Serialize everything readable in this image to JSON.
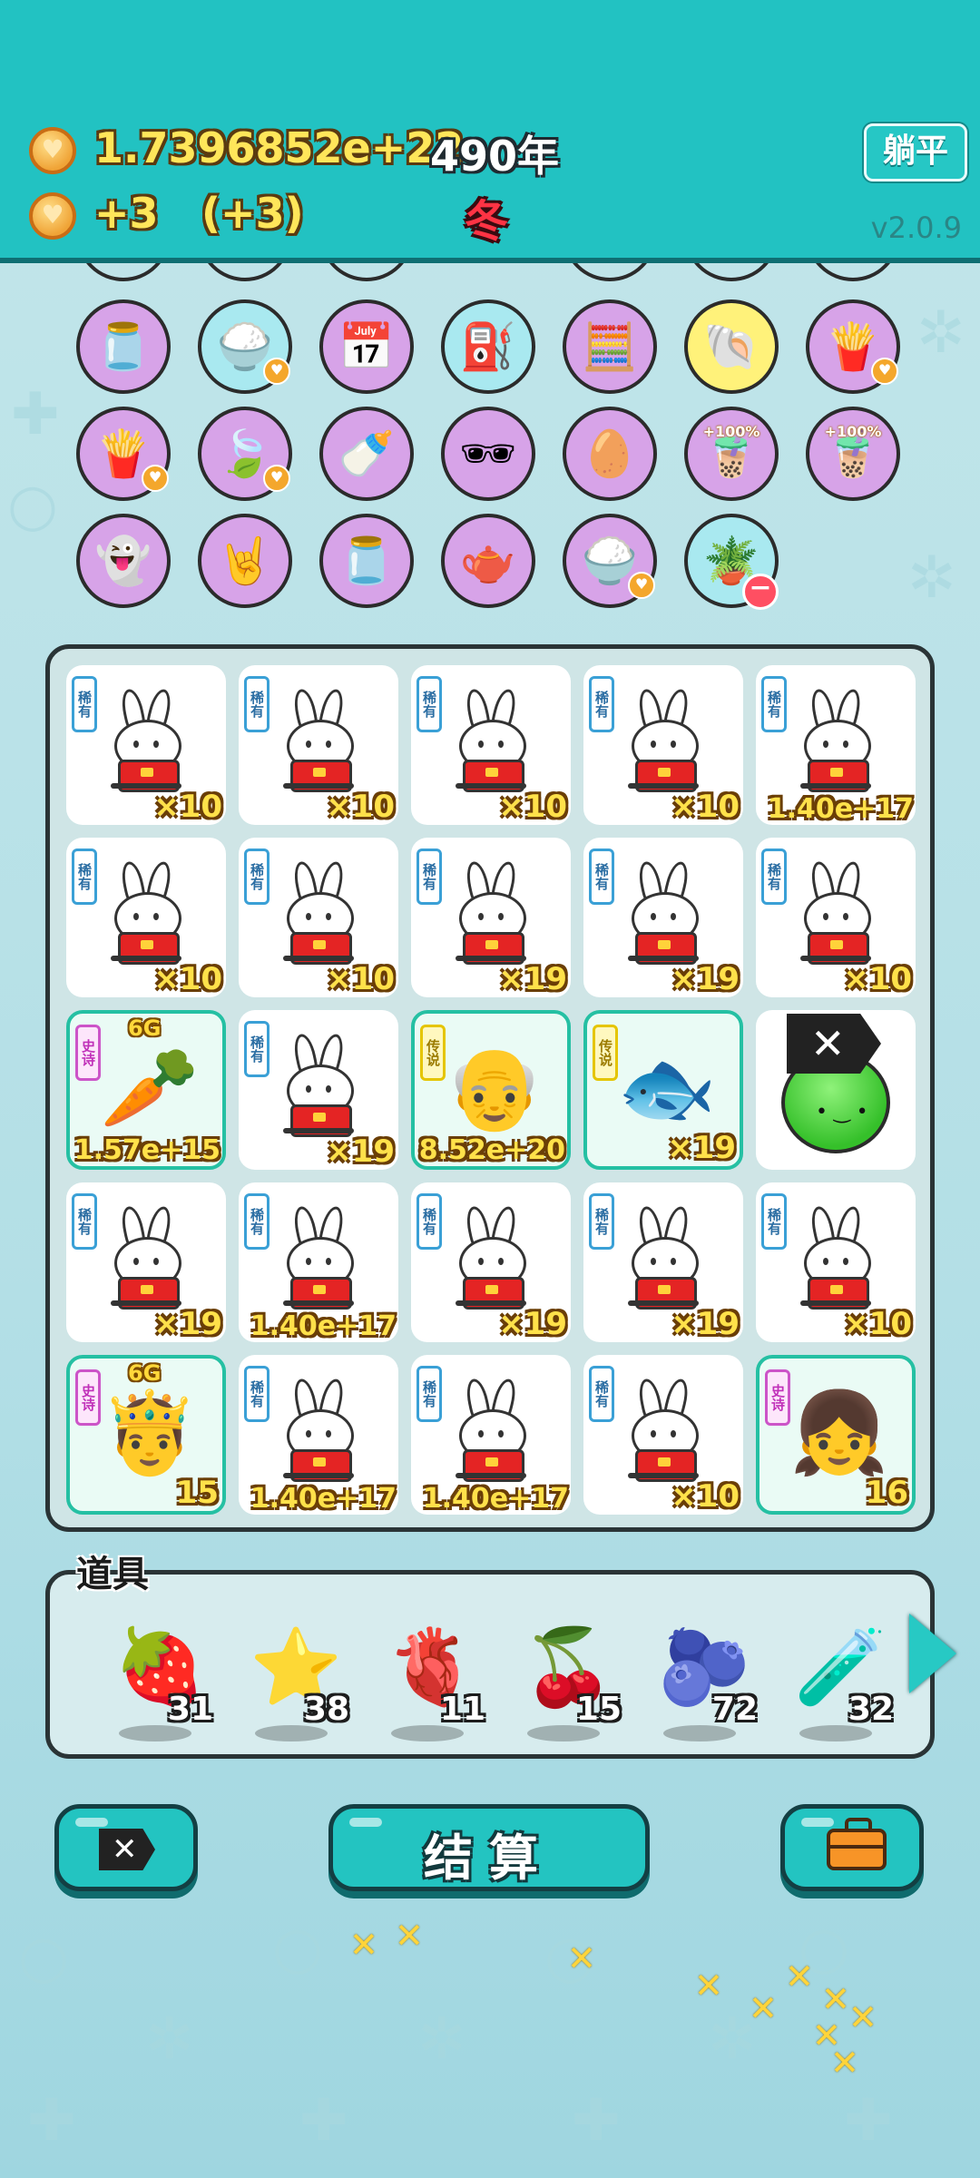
{
  "header": {
    "money": "1.7396852e+22",
    "year": "490年",
    "income": "+3",
    "income_bonus": "(+3)",
    "season": "冬",
    "lie_flat_label": "躺平",
    "version": "v2.0.9"
  },
  "relics": [
    {
      "icon": "jar-icon",
      "glyph": "🫙",
      "bg": "purple"
    },
    {
      "icon": "rice-bowl-icon",
      "glyph": "🍚",
      "bg": "cyan",
      "heart": true
    },
    {
      "icon": "calendar-icon",
      "glyph": "📅",
      "bg": "purple"
    },
    {
      "icon": "pump-icon",
      "glyph": "⛽",
      "bg": "cyan"
    },
    {
      "icon": "math-student-icon",
      "glyph": "🧮",
      "bg": "purple"
    },
    {
      "icon": "shell-icon",
      "glyph": "🐚",
      "bg": "yellow"
    },
    {
      "icon": "fries-icon",
      "glyph": "🍟",
      "bg": "purple",
      "heart": true
    },
    {
      "icon": "fries-icon",
      "glyph": "🍟",
      "bg": "purple",
      "heart": true
    },
    {
      "icon": "leaf-icon",
      "glyph": "🍃",
      "bg": "purple",
      "heart": true
    },
    {
      "icon": "milk-bottle-icon",
      "glyph": "🍼",
      "bg": "purple"
    },
    {
      "icon": "sunglasses-icon",
      "glyph": "🕶",
      "bg": "purple"
    },
    {
      "icon": "egg-icon",
      "glyph": "🥚",
      "bg": "purple"
    },
    {
      "icon": "bubble-tea-icon",
      "glyph": "🧋",
      "bg": "purple",
      "pct": "+100%"
    },
    {
      "icon": "bubble-tea-icon",
      "glyph": "🧋",
      "bg": "purple",
      "pct": "+100%"
    },
    {
      "icon": "ghost-icon",
      "glyph": "👻",
      "bg": "purple"
    },
    {
      "icon": "rock-hand-icon",
      "glyph": "🤘",
      "bg": "purple"
    },
    {
      "icon": "jar-icon",
      "glyph": "🫙",
      "bg": "purple"
    },
    {
      "icon": "gravy-boat-icon",
      "glyph": "🫖",
      "bg": "purple"
    },
    {
      "icon": "rice-bowl-icon",
      "glyph": "🍚",
      "bg": "purple",
      "heart": true
    },
    {
      "icon": "flower-pot-icon",
      "glyph": "🪴",
      "bg": "cyan",
      "minus": true
    }
  ],
  "board": [
    {
      "type": "rabbit",
      "tag": "稀有",
      "count": "×10"
    },
    {
      "type": "rabbit",
      "tag": "稀有",
      "count": "×10"
    },
    {
      "type": "rabbit",
      "tag": "稀有",
      "count": "×10"
    },
    {
      "type": "rabbit",
      "tag": "稀有",
      "count": "×10"
    },
    {
      "type": "rabbit",
      "tag": "稀有",
      "count": "1.40e+17"
    },
    {
      "type": "rabbit",
      "tag": "稀有",
      "count": "×10"
    },
    {
      "type": "rabbit",
      "tag": "稀有",
      "count": "×10"
    },
    {
      "type": "rabbit",
      "tag": "稀有",
      "count": "×19"
    },
    {
      "type": "rabbit",
      "tag": "稀有",
      "count": "×19"
    },
    {
      "type": "rabbit",
      "tag": "稀有",
      "count": "×10"
    },
    {
      "type": "emoji",
      "tag": "史诗",
      "glyph": "🥕",
      "icon": "carrot-icon",
      "count": "1.57e+15",
      "hl": true,
      "badge": "6G"
    },
    {
      "type": "rabbit",
      "tag": "稀有",
      "count": "×19"
    },
    {
      "type": "emoji",
      "tag": "传说",
      "glyph": "👴",
      "icon": "grinning-old-man-icon",
      "count": "8.52e+20",
      "hl": true
    },
    {
      "type": "emoji",
      "tag": "传说",
      "glyph": "🐟",
      "icon": "koi-fish-icon",
      "count": "×19",
      "hl": true
    },
    {
      "type": "delete",
      "glyph": "🟢",
      "icon": "green-slime-icon"
    },
    {
      "type": "rabbit",
      "tag": "稀有",
      "count": "×19"
    },
    {
      "type": "rabbit",
      "tag": "稀有",
      "count": "1.40e+17"
    },
    {
      "type": "rabbit",
      "tag": "稀有",
      "count": "×19"
    },
    {
      "type": "rabbit",
      "tag": "稀有",
      "count": "×19"
    },
    {
      "type": "rabbit",
      "tag": "稀有",
      "count": "×10"
    },
    {
      "type": "emoji",
      "tag": "史诗",
      "glyph": "🤴",
      "icon": "crowned-grandpa-icon",
      "count": "15",
      "hl": true,
      "badge": "6G"
    },
    {
      "type": "rabbit",
      "tag": "稀有",
      "count": "1.40e+17"
    },
    {
      "type": "rabbit",
      "tag": "稀有",
      "count": "1.40e+17"
    },
    {
      "type": "rabbit",
      "tag": "稀有",
      "count": "×10"
    },
    {
      "type": "emoji",
      "tag": "史诗",
      "glyph": "👧",
      "icon": "girl-with-bow-icon",
      "count": "16",
      "hl": true
    }
  ],
  "items_label": "道具",
  "items": [
    {
      "icon": "strawberry-icon",
      "glyph": "🍓",
      "count": "31"
    },
    {
      "icon": "star-icon",
      "glyph": "⭐",
      "count": "38"
    },
    {
      "icon": "liver-icon",
      "glyph": "🫀",
      "count": "11"
    },
    {
      "icon": "bayberry-icon",
      "glyph": "🍒",
      "count": "15"
    },
    {
      "icon": "blueberry-icon",
      "glyph": "🫐",
      "count": "72"
    },
    {
      "icon": "glass-bottles-icon",
      "glyph": "🧪",
      "count": "32"
    }
  ],
  "buttons": {
    "delete_glyph": "✕",
    "settle_label": "结算"
  },
  "colors": {
    "header": "#22c2c2",
    "accent": "#23c4c1",
    "money_text": "#ffe65a",
    "season_text": "#ff3344"
  }
}
